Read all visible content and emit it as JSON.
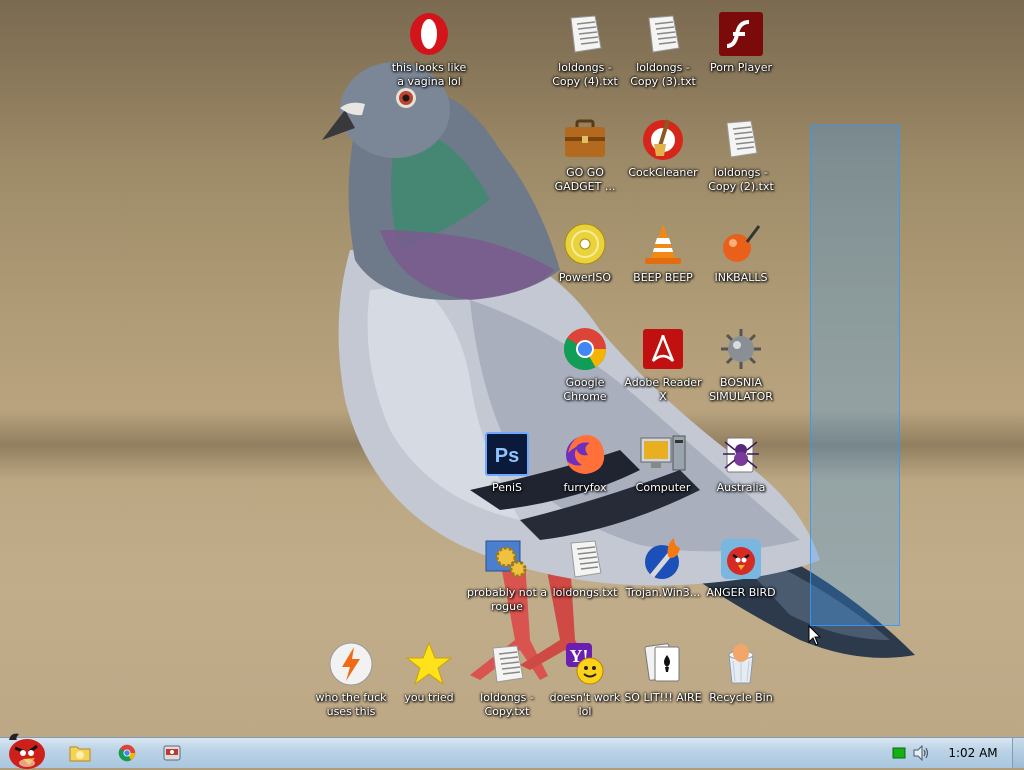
{
  "desktop": {
    "icons": [
      {
        "label": "this looks like a vagina lol",
        "icon": "opera-icon"
      },
      {
        "label": "loldongs - Copy (4).txt",
        "icon": "text-file-icon"
      },
      {
        "label": "loldongs - Copy (3).txt",
        "icon": "text-file-icon"
      },
      {
        "label": "Porn Player",
        "icon": "flash-player-icon"
      },
      {
        "label": "GO GO GADGET ...",
        "icon": "briefcase-icon"
      },
      {
        "label": "CockCleaner",
        "icon": "ccleaner-icon"
      },
      {
        "label": "loldongs - Copy (2).txt",
        "icon": "text-file-icon"
      },
      {
        "label": "PowerISO",
        "icon": "disc-icon"
      },
      {
        "label": "BEEP BEEP",
        "icon": "vlc-cone-icon"
      },
      {
        "label": "INKBALLS",
        "icon": "inkball-icon"
      },
      {
        "label": "Google Chrome",
        "icon": "chrome-icon"
      },
      {
        "label": "Adobe Reader X",
        "icon": "adobe-reader-icon"
      },
      {
        "label": "BOSNIA SIMULATOR",
        "icon": "mine-icon"
      },
      {
        "label": "PeniS",
        "icon": "photoshop-icon"
      },
      {
        "label": "furryfox",
        "icon": "firefox-icon"
      },
      {
        "label": "Computer",
        "icon": "computer-icon"
      },
      {
        "label": "Australia",
        "icon": "spider-solitaire-icon"
      },
      {
        "label": "probably not a rogue",
        "icon": "settings-gears-icon"
      },
      {
        "label": "loldongs.txt",
        "icon": "text-file-icon"
      },
      {
        "label": "Trojan.Win3...",
        "icon": "torch-icon"
      },
      {
        "label": "ANGER BIRD",
        "icon": "angry-bird-icon"
      },
      {
        "label": "who the fuck uses this",
        "icon": "avast-icon"
      },
      {
        "label": "you tried",
        "icon": "star-icon"
      },
      {
        "label": "loldongs - Copy.txt",
        "icon": "text-file-icon"
      },
      {
        "label": "doesn't work lol",
        "icon": "yahoo-messenger-icon"
      },
      {
        "label": "SO LIT!!! AIRE",
        "icon": "solitaire-icon"
      },
      {
        "label": "Recycle Bin",
        "icon": "recycle-bin-icon"
      }
    ]
  },
  "taskbar": {
    "start_icon": "angry-bird-icon",
    "pinned": [
      {
        "icon": "folder-icon"
      },
      {
        "icon": "chrome-icon"
      },
      {
        "icon": "app-icon"
      }
    ],
    "tray": {
      "icons": [
        "action-center-flag-icon",
        "volume-icon"
      ],
      "clock": "1:02 AM"
    }
  },
  "colors": {
    "label_text": "#ffffff",
    "selection": "#3399ff",
    "taskbar": "#bcd3e6"
  }
}
